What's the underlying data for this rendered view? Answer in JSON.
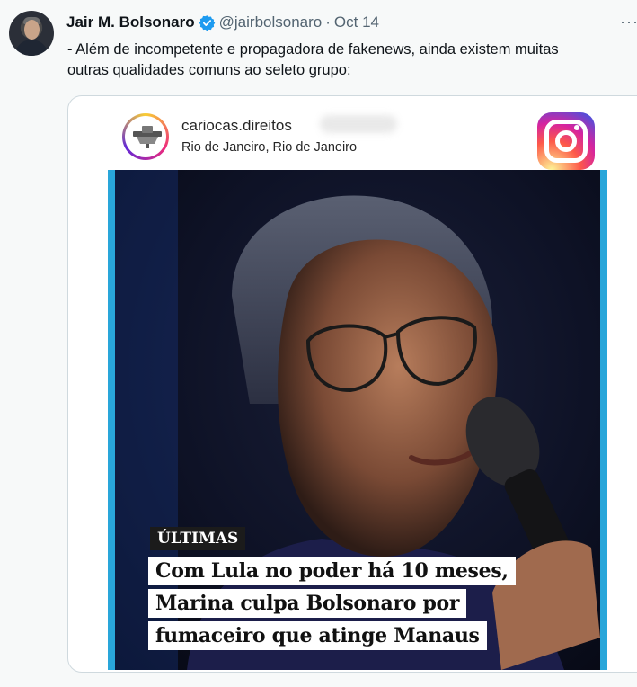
{
  "tweet": {
    "author_name": "Jair M. Bolsonaro",
    "handle": "@jairbolsonaro",
    "separator": "·",
    "date": "Oct 14",
    "more": "···",
    "text_line1": "- Além de incompetente e propagadora de fakenews, ainda existem muitas",
    "text_line2": "outras qualidades comuns ao seleto grupo:"
  },
  "media": {
    "instagram_header": {
      "username": "cariocas.direitos",
      "location": "Rio de Janeiro, Rio de Janeiro"
    },
    "badge": "ÚLTIMAS",
    "headline": [
      "Com Lula no poder há 10 meses,",
      "Marina culpa Bolsonaro por",
      "fumaceiro que atinge Manaus"
    ]
  },
  "colors": {
    "verified_blue": "#1d9bf0",
    "photo_frame": "#29a6da",
    "text_secondary": "#536471"
  },
  "icons": [
    "verified-badge-icon",
    "more-options-icon",
    "instagram-logo-icon"
  ]
}
